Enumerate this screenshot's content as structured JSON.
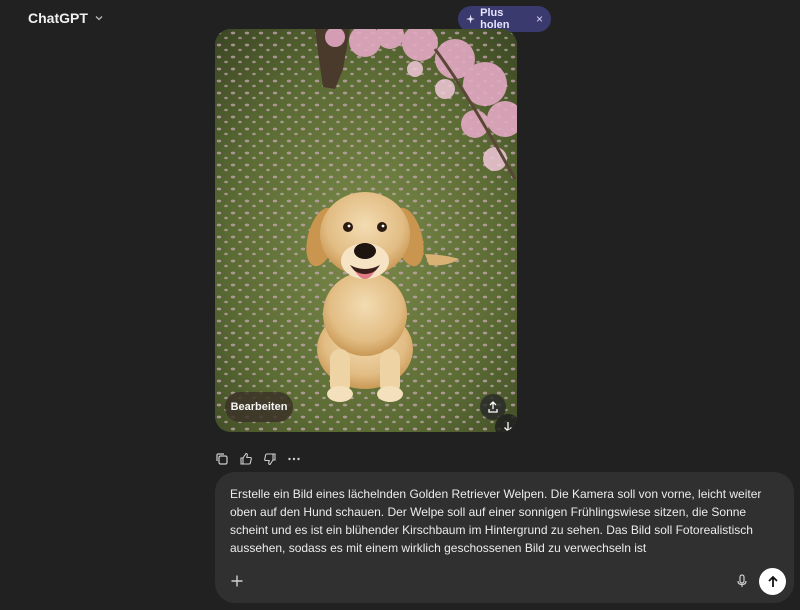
{
  "header": {
    "model_name": "ChatGPT",
    "plus_label": "Plus holen",
    "plus_close": "×"
  },
  "image": {
    "description_icon": "golden-retriever-puppy-image",
    "edit_label": "Bearbeiten"
  },
  "message_actions": [
    "copy-icon",
    "thumbs-up-icon",
    "thumbs-down-icon",
    "more-icon"
  ],
  "composer": {
    "prompt_text": "Erstelle ein Bild eines lächelnden Golden Retriever Welpen. Die Kamera soll von vorne, leicht weiter oben auf den Hund schauen. Der Welpe soll auf einer sonnigen Frühlingswiese sitzen, die Sonne scheint und es ist ein blühender Kirschbaum im Hintergrund zu sehen. Das Bild soll Fotorealistisch aussehen, sodass es mit einem wirklich geschossenen Bild zu verwechseln ist"
  },
  "colors": {
    "background": "#212121",
    "composer": "#303030",
    "plus_pill": "#3b3a6e"
  }
}
